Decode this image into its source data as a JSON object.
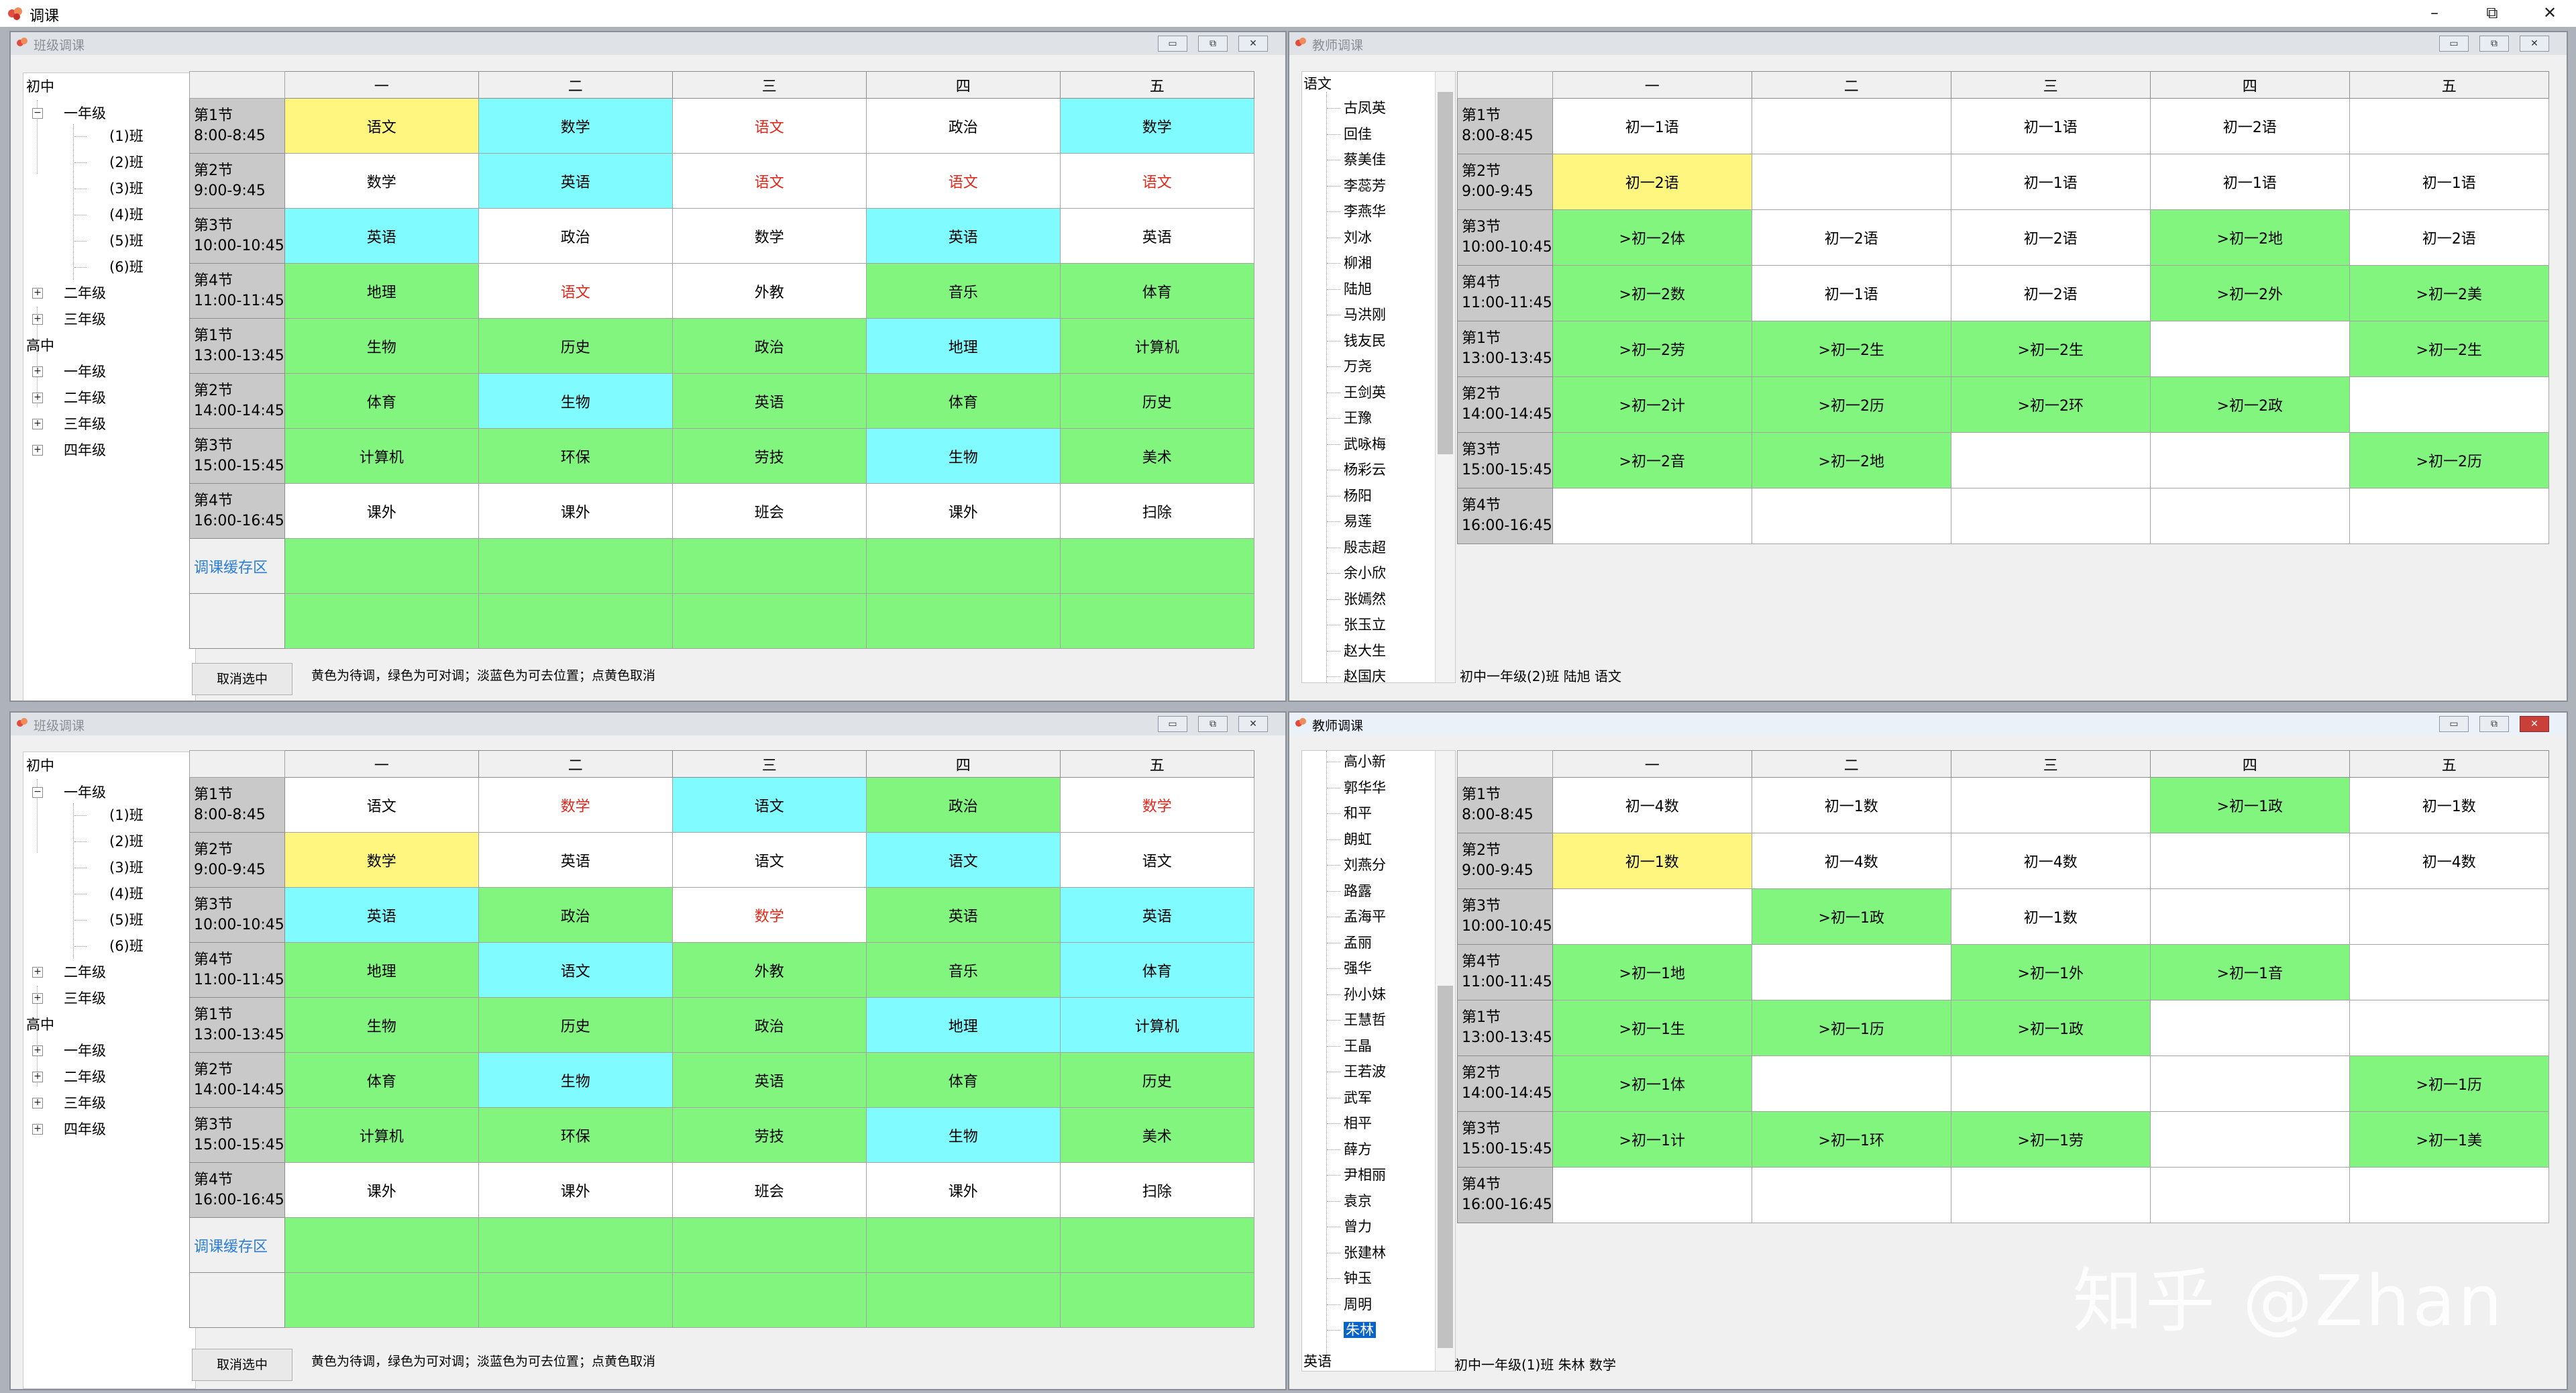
{
  "app": {
    "title": "调课"
  },
  "days": [
    "一",
    "二",
    "三",
    "四",
    "五"
  ],
  "periods": [
    [
      "第1节",
      "8:00-8:45"
    ],
    [
      "第2节",
      "9:00-9:45"
    ],
    [
      "第3节",
      "10:00-10:45"
    ],
    [
      "第4节",
      "11:00-11:45"
    ],
    [
      "第1节",
      "13:00-13:45"
    ],
    [
      "第2节",
      "14:00-14:45"
    ],
    [
      "第3节",
      "15:00-15:45"
    ],
    [
      "第4节",
      "16:00-16:45"
    ]
  ],
  "tree": {
    "junior": "初中",
    "senior": "高中",
    "grade1": "一年级",
    "grade2": "二年级",
    "grade3": "三年级",
    "grade4": "四年级",
    "classes": [
      "(1)班",
      "(2)班",
      "(3)班",
      "(4)班",
      "(5)班",
      "(6)班"
    ]
  },
  "cache_label": "调课缓存区",
  "cancel_label": "取消选中",
  "legend_hint": "黄色为待调，绿色为可对调；淡蓝色为可去位置；点黄色取消",
  "class_window_1": {
    "title": "班级调课",
    "cells": [
      [
        {
          "t": "语文",
          "c": "#fff680"
        },
        {
          "t": "数学",
          "c": "#80fbff"
        },
        {
          "t": "语文",
          "c": "#ffffff",
          "red": true
        },
        {
          "t": "政治",
          "c": "#ffffff"
        },
        {
          "t": "数学",
          "c": "#80fbff"
        }
      ],
      [
        {
          "t": "数学",
          "c": "#ffffff"
        },
        {
          "t": "英语",
          "c": "#80fbff"
        },
        {
          "t": "语文",
          "c": "#ffffff",
          "red": true
        },
        {
          "t": "语文",
          "c": "#ffffff",
          "red": true
        },
        {
          "t": "语文",
          "c": "#ffffff",
          "red": true
        }
      ],
      [
        {
          "t": "英语",
          "c": "#80fbff"
        },
        {
          "t": "政治",
          "c": "#ffffff"
        },
        {
          "t": "数学",
          "c": "#ffffff"
        },
        {
          "t": "英语",
          "c": "#80fbff"
        },
        {
          "t": "英语",
          "c": "#ffffff"
        }
      ],
      [
        {
          "t": "地理",
          "c": "#82f57f"
        },
        {
          "t": "语文",
          "c": "#ffffff",
          "red": true
        },
        {
          "t": "外教",
          "c": "#ffffff"
        },
        {
          "t": "音乐",
          "c": "#82f57f"
        },
        {
          "t": "体育",
          "c": "#82f57f"
        }
      ],
      [
        {
          "t": "生物",
          "c": "#82f57f"
        },
        {
          "t": "历史",
          "c": "#82f57f"
        },
        {
          "t": "政治",
          "c": "#82f57f"
        },
        {
          "t": "地理",
          "c": "#80fbff"
        },
        {
          "t": "计算机",
          "c": "#82f57f"
        }
      ],
      [
        {
          "t": "体育",
          "c": "#82f57f"
        },
        {
          "t": "生物",
          "c": "#80fbff"
        },
        {
          "t": "英语",
          "c": "#82f57f"
        },
        {
          "t": "体育",
          "c": "#82f57f"
        },
        {
          "t": "历史",
          "c": "#82f57f"
        }
      ],
      [
        {
          "t": "计算机",
          "c": "#82f57f"
        },
        {
          "t": "环保",
          "c": "#82f57f"
        },
        {
          "t": "劳技",
          "c": "#82f57f"
        },
        {
          "t": "生物",
          "c": "#80fbff"
        },
        {
          "t": "美术",
          "c": "#82f57f"
        }
      ],
      [
        {
          "t": "课外",
          "c": "#ffffff"
        },
        {
          "t": "课外",
          "c": "#ffffff"
        },
        {
          "t": "班会",
          "c": "#ffffff"
        },
        {
          "t": "课外",
          "c": "#ffffff"
        },
        {
          "t": "扫除",
          "c": "#ffffff"
        }
      ]
    ]
  },
  "class_window_2": {
    "title": "班级调课",
    "cells": [
      [
        {
          "t": "语文",
          "c": "#ffffff"
        },
        {
          "t": "数学",
          "c": "#ffffff",
          "red": true
        },
        {
          "t": "语文",
          "c": "#80fbff"
        },
        {
          "t": "政治",
          "c": "#82f57f"
        },
        {
          "t": "数学",
          "c": "#ffffff",
          "red": true
        }
      ],
      [
        {
          "t": "数学",
          "c": "#fff680"
        },
        {
          "t": "英语",
          "c": "#ffffff"
        },
        {
          "t": "语文",
          "c": "#ffffff"
        },
        {
          "t": "语文",
          "c": "#80fbff"
        },
        {
          "t": "语文",
          "c": "#ffffff"
        }
      ],
      [
        {
          "t": "英语",
          "c": "#80fbff"
        },
        {
          "t": "政治",
          "c": "#82f57f"
        },
        {
          "t": "数学",
          "c": "#ffffff",
          "red": true
        },
        {
          "t": "英语",
          "c": "#82f57f"
        },
        {
          "t": "英语",
          "c": "#80fbff"
        }
      ],
      [
        {
          "t": "地理",
          "c": "#82f57f"
        },
        {
          "t": "语文",
          "c": "#80fbff"
        },
        {
          "t": "外教",
          "c": "#82f57f"
        },
        {
          "t": "音乐",
          "c": "#82f57f"
        },
        {
          "t": "体育",
          "c": "#80fbff"
        }
      ],
      [
        {
          "t": "生物",
          "c": "#82f57f"
        },
        {
          "t": "历史",
          "c": "#82f57f"
        },
        {
          "t": "政治",
          "c": "#82f57f"
        },
        {
          "t": "地理",
          "c": "#80fbff"
        },
        {
          "t": "计算机",
          "c": "#80fbff"
        }
      ],
      [
        {
          "t": "体育",
          "c": "#82f57f"
        },
        {
          "t": "生物",
          "c": "#80fbff"
        },
        {
          "t": "英语",
          "c": "#82f57f"
        },
        {
          "t": "体育",
          "c": "#82f57f"
        },
        {
          "t": "历史",
          "c": "#82f57f"
        }
      ],
      [
        {
          "t": "计算机",
          "c": "#82f57f"
        },
        {
          "t": "环保",
          "c": "#82f57f"
        },
        {
          "t": "劳技",
          "c": "#82f57f"
        },
        {
          "t": "生物",
          "c": "#80fbff"
        },
        {
          "t": "美术",
          "c": "#82f57f"
        }
      ],
      [
        {
          "t": "课外",
          "c": "#ffffff"
        },
        {
          "t": "课外",
          "c": "#ffffff"
        },
        {
          "t": "班会",
          "c": "#ffffff"
        },
        {
          "t": "课外",
          "c": "#ffffff"
        },
        {
          "t": "扫除",
          "c": "#ffffff"
        }
      ]
    ]
  },
  "teacher_window_1": {
    "title": "教师调课",
    "subject_top": "语文",
    "teachers": [
      "古凤英",
      "回佳",
      "蔡美佳",
      "李蕊芳",
      "李燕华",
      "刘冰",
      "柳湘",
      "陆旭",
      "马洪刚",
      "钱友民",
      "万尧",
      "王剑英",
      "王豫",
      "武咏梅",
      "杨彩云",
      "杨阳",
      "易莲",
      "殷志超",
      "余小欣",
      "张嫣然",
      "张玉立",
      "赵大生",
      "赵国庆"
    ],
    "status": "初中一年级(2)班 陆旭 语文",
    "cells": [
      [
        {
          "t": "初一1语",
          "c": "#ffffff"
        },
        {
          "t": "",
          "c": "#ffffff"
        },
        {
          "t": "初一1语",
          "c": "#ffffff"
        },
        {
          "t": "初一2语",
          "c": "#ffffff"
        },
        {
          "t": "",
          "c": "#ffffff"
        }
      ],
      [
        {
          "t": "初一2语",
          "c": "#fff680"
        },
        {
          "t": "",
          "c": "#ffffff"
        },
        {
          "t": "初一1语",
          "c": "#ffffff"
        },
        {
          "t": "初一1语",
          "c": "#ffffff"
        },
        {
          "t": "初一1语",
          "c": "#ffffff"
        }
      ],
      [
        {
          "t": ">初一2体",
          "c": "#82f57f"
        },
        {
          "t": "初一2语",
          "c": "#ffffff"
        },
        {
          "t": "初一2语",
          "c": "#ffffff"
        },
        {
          "t": ">初一2地",
          "c": "#82f57f"
        },
        {
          "t": "初一2语",
          "c": "#ffffff"
        }
      ],
      [
        {
          "t": ">初一2数",
          "c": "#82f57f"
        },
        {
          "t": "初一1语",
          "c": "#ffffff"
        },
        {
          "t": "初一2语",
          "c": "#ffffff"
        },
        {
          "t": ">初一2外",
          "c": "#82f57f"
        },
        {
          "t": ">初一2美",
          "c": "#82f57f"
        }
      ],
      [
        {
          "t": ">初一2劳",
          "c": "#82f57f"
        },
        {
          "t": ">初一2生",
          "c": "#82f57f"
        },
        {
          "t": ">初一2生",
          "c": "#82f57f"
        },
        {
          "t": "",
          "c": "#ffffff"
        },
        {
          "t": ">初一2生",
          "c": "#82f57f"
        }
      ],
      [
        {
          "t": ">初一2计",
          "c": "#82f57f"
        },
        {
          "t": ">初一2历",
          "c": "#82f57f"
        },
        {
          "t": ">初一2环",
          "c": "#82f57f"
        },
        {
          "t": ">初一2政",
          "c": "#82f57f"
        },
        {
          "t": "",
          "c": "#ffffff"
        }
      ],
      [
        {
          "t": ">初一2音",
          "c": "#82f57f"
        },
        {
          "t": ">初一2地",
          "c": "#82f57f"
        },
        {
          "t": "",
          "c": "#ffffff"
        },
        {
          "t": "",
          "c": "#ffffff"
        },
        {
          "t": ">初一2历",
          "c": "#82f57f"
        }
      ],
      [
        {
          "t": "",
          "c": "#ffffff"
        },
        {
          "t": "",
          "c": "#ffffff"
        },
        {
          "t": "",
          "c": "#ffffff"
        },
        {
          "t": "",
          "c": "#ffffff"
        },
        {
          "t": "",
          "c": "#ffffff"
        }
      ]
    ]
  },
  "teacher_window_2": {
    "title": "教师调课",
    "subject_bottom": "英语",
    "teachers": [
      "高小新",
      "郭华华",
      "和平",
      "朗虹",
      "刘燕分",
      "路露",
      "孟海平",
      "孟丽",
      "强华",
      "孙小妹",
      "王慧哲",
      "王晶",
      "王若波",
      "武军",
      "相平",
      "薛方",
      "尹相丽",
      "袁京",
      "曾力",
      "张建林",
      "钟玉",
      "周明",
      "朱林"
    ],
    "selected_teacher": "朱林",
    "status": "初中一年级(1)班 朱林 数学",
    "cells": [
      [
        {
          "t": "初一4数",
          "c": "#ffffff"
        },
        {
          "t": "初一1数",
          "c": "#ffffff"
        },
        {
          "t": "",
          "c": "#ffffff"
        },
        {
          "t": ">初一1政",
          "c": "#82f57f"
        },
        {
          "t": "初一1数",
          "c": "#ffffff"
        }
      ],
      [
        {
          "t": "初一1数",
          "c": "#fff680"
        },
        {
          "t": "初一4数",
          "c": "#ffffff"
        },
        {
          "t": "初一4数",
          "c": "#ffffff"
        },
        {
          "t": "",
          "c": "#ffffff"
        },
        {
          "t": "初一4数",
          "c": "#ffffff"
        }
      ],
      [
        {
          "t": "",
          "c": "#ffffff"
        },
        {
          "t": ">初一1政",
          "c": "#82f57f"
        },
        {
          "t": "初一1数",
          "c": "#ffffff"
        },
        {
          "t": "",
          "c": "#ffffff"
        },
        {
          "t": "",
          "c": "#ffffff"
        }
      ],
      [
        {
          "t": ">初一1地",
          "c": "#82f57f"
        },
        {
          "t": "",
          "c": "#ffffff"
        },
        {
          "t": ">初一1外",
          "c": "#82f57f"
        },
        {
          "t": ">初一1音",
          "c": "#82f57f"
        },
        {
          "t": "",
          "c": "#ffffff"
        }
      ],
      [
        {
          "t": ">初一1生",
          "c": "#82f57f"
        },
        {
          "t": ">初一1历",
          "c": "#82f57f"
        },
        {
          "t": ">初一1政",
          "c": "#82f57f"
        },
        {
          "t": "",
          "c": "#ffffff"
        },
        {
          "t": "",
          "c": "#ffffff"
        }
      ],
      [
        {
          "t": ">初一1体",
          "c": "#82f57f"
        },
        {
          "t": "",
          "c": "#ffffff"
        },
        {
          "t": "",
          "c": "#ffffff"
        },
        {
          "t": "",
          "c": "#ffffff"
        },
        {
          "t": ">初一1历",
          "c": "#82f57f"
        }
      ],
      [
        {
          "t": ">初一1计",
          "c": "#82f57f"
        },
        {
          "t": ">初一1环",
          "c": "#82f57f"
        },
        {
          "t": ">初一1劳",
          "c": "#82f57f"
        },
        {
          "t": "",
          "c": "#ffffff"
        },
        {
          "t": ">初一1美",
          "c": "#82f57f"
        }
      ],
      [
        {
          "t": "",
          "c": "#ffffff"
        },
        {
          "t": "",
          "c": "#ffffff"
        },
        {
          "t": "",
          "c": "#ffffff"
        },
        {
          "t": "",
          "c": "#ffffff"
        },
        {
          "t": "",
          "c": "#ffffff"
        }
      ]
    ]
  },
  "watermark": "知乎 @Zhan",
  "icons": {
    "app": "tulip-logo-icon",
    "minimize": "minimize-icon",
    "restore": "restore-icon",
    "close": "close-icon"
  },
  "colors": {
    "pending": "#fff680",
    "swappable": "#82f57f",
    "movable": "#80fbff",
    "cache": "#82f57f",
    "conflict_text": "#e0281c"
  }
}
